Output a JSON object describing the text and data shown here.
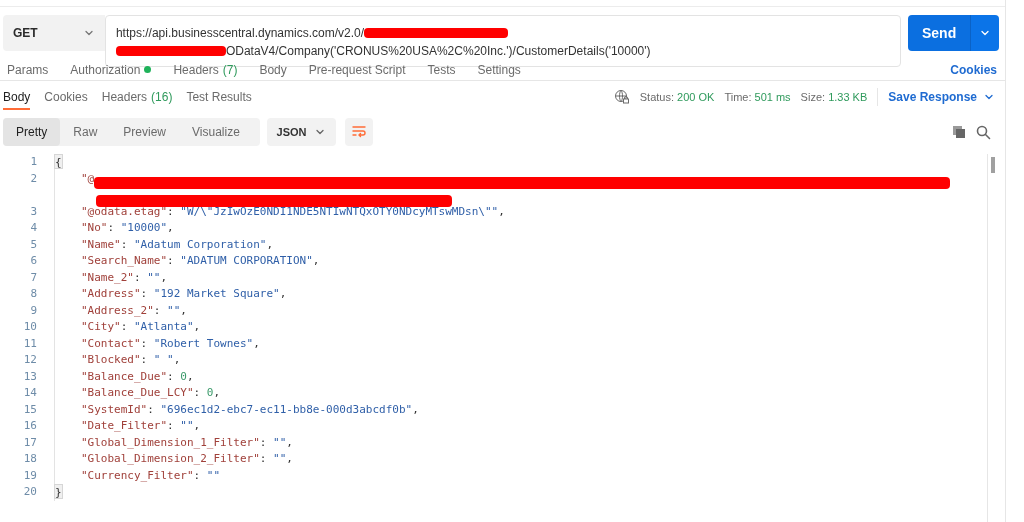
{
  "request": {
    "method": "GET",
    "url_line_1": "https://api.businesscentral.dynamics.com/v2.0/",
    "url_line_2": "ODataV4/Company('CRONUS%20USA%2C%20Inc.')/CustomerDetails('10000')",
    "send_label": "Send"
  },
  "request_tabs": [
    {
      "label": "Params",
      "selected": false
    },
    {
      "label": "Authorization",
      "dot": true,
      "selected": false
    },
    {
      "label": "Headers",
      "count": "(7)",
      "selected": false
    },
    {
      "label": "Body",
      "selected": false
    },
    {
      "label": "Pre-request Script",
      "selected": false
    },
    {
      "label": "Tests",
      "selected": false
    },
    {
      "label": "Settings",
      "selected": false
    }
  ],
  "cookies_link": "Cookies",
  "response_tabs": [
    {
      "label": "Body",
      "selected": true
    },
    {
      "label": "Cookies",
      "selected": false
    },
    {
      "label": "Headers",
      "count": "(16)",
      "selected": false
    },
    {
      "label": "Test Results",
      "selected": false
    }
  ],
  "status": [
    {
      "label": "Status:",
      "value": "200 OK"
    },
    {
      "label": "Time:",
      "value": "501 ms"
    },
    {
      "label": "Size:",
      "value": "1.33 KB"
    }
  ],
  "save_response": "Save Response",
  "view_modes": [
    {
      "label": "Pretty",
      "selected": true
    },
    {
      "label": "Raw",
      "selected": false
    },
    {
      "label": "Preview",
      "selected": false
    },
    {
      "label": "Visualize",
      "selected": false
    }
  ],
  "format": "JSON",
  "code_lines": [
    {
      "number": "1",
      "parts": [
        {
          "kind": "brace",
          "text": "{"
        }
      ]
    },
    {
      "number": "2",
      "parts": [
        {
          "kind": "key",
          "text": "\"@"
        },
        {
          "kind": "redaction"
        }
      ]
    },
    {
      "number": "3",
      "parts": [
        {
          "kind": "key",
          "text": "\"@odata.etag\""
        },
        {
          "kind": "punct",
          "text": ": "
        },
        {
          "kind": "string",
          "text": "\"W/\\\"JzIwOzE0NDI1NDE5NTIwNTQxOTY0NDcyMTswMDsn\\\"\""
        },
        {
          "kind": "punct",
          "text": ","
        }
      ]
    },
    {
      "number": "4",
      "parts": [
        {
          "kind": "key",
          "text": "\"No\""
        },
        {
          "kind": "punct",
          "text": ": "
        },
        {
          "kind": "string",
          "text": "\"10000\""
        },
        {
          "kind": "punct",
          "text": ","
        }
      ]
    },
    {
      "number": "5",
      "parts": [
        {
          "kind": "key",
          "text": "\"Name\""
        },
        {
          "kind": "punct",
          "text": ": "
        },
        {
          "kind": "string",
          "text": "\"Adatum Corporation\""
        },
        {
          "kind": "punct",
          "text": ","
        }
      ]
    },
    {
      "number": "6",
      "parts": [
        {
          "kind": "key",
          "text": "\"Search_Name\""
        },
        {
          "kind": "punct",
          "text": ": "
        },
        {
          "kind": "string",
          "text": "\"ADATUM CORPORATION\""
        },
        {
          "kind": "punct",
          "text": ","
        }
      ]
    },
    {
      "number": "7",
      "parts": [
        {
          "kind": "key",
          "text": "\"Name_2\""
        },
        {
          "kind": "punct",
          "text": ": "
        },
        {
          "kind": "string",
          "text": "\"\""
        },
        {
          "kind": "punct",
          "text": ","
        }
      ]
    },
    {
      "number": "8",
      "parts": [
        {
          "kind": "key",
          "text": "\"Address\""
        },
        {
          "kind": "punct",
          "text": ": "
        },
        {
          "kind": "string",
          "text": "\"192 Market Square\""
        },
        {
          "kind": "punct",
          "text": ","
        }
      ]
    },
    {
      "number": "9",
      "parts": [
        {
          "kind": "key",
          "text": "\"Address_2\""
        },
        {
          "kind": "punct",
          "text": ": "
        },
        {
          "kind": "string",
          "text": "\"\""
        },
        {
          "kind": "punct",
          "text": ","
        }
      ]
    },
    {
      "number": "10",
      "parts": [
        {
          "kind": "key",
          "text": "\"City\""
        },
        {
          "kind": "punct",
          "text": ": "
        },
        {
          "kind": "string",
          "text": "\"Atlanta\""
        },
        {
          "kind": "punct",
          "text": ","
        }
      ]
    },
    {
      "number": "11",
      "parts": [
        {
          "kind": "key",
          "text": "\"Contact\""
        },
        {
          "kind": "punct",
          "text": ": "
        },
        {
          "kind": "string",
          "text": "\"Robert Townes\""
        },
        {
          "kind": "punct",
          "text": ","
        }
      ]
    },
    {
      "number": "12",
      "parts": [
        {
          "kind": "key",
          "text": "\"Blocked\""
        },
        {
          "kind": "punct",
          "text": ": "
        },
        {
          "kind": "string",
          "text": "\" \""
        },
        {
          "kind": "punct",
          "text": ","
        }
      ]
    },
    {
      "number": "13",
      "parts": [
        {
          "kind": "key",
          "text": "\"Balance_Due\""
        },
        {
          "kind": "punct",
          "text": ": "
        },
        {
          "kind": "number",
          "text": "0"
        },
        {
          "kind": "punct",
          "text": ","
        }
      ]
    },
    {
      "number": "14",
      "parts": [
        {
          "kind": "key",
          "text": "\"Balance_Due_LCY\""
        },
        {
          "kind": "punct",
          "text": ": "
        },
        {
          "kind": "number",
          "text": "0"
        },
        {
          "kind": "punct",
          "text": ","
        }
      ]
    },
    {
      "number": "15",
      "parts": [
        {
          "kind": "key",
          "text": "\"SystemId\""
        },
        {
          "kind": "punct",
          "text": ": "
        },
        {
          "kind": "string",
          "text": "\"696ec1d2-ebc7-ec11-bb8e-000d3abcdf0b\""
        },
        {
          "kind": "punct",
          "text": ","
        }
      ]
    },
    {
      "number": "16",
      "parts": [
        {
          "kind": "key",
          "text": "\"Date_Filter\""
        },
        {
          "kind": "punct",
          "text": ": "
        },
        {
          "kind": "string",
          "text": "\"\""
        },
        {
          "kind": "punct",
          "text": ","
        }
      ]
    },
    {
      "number": "17",
      "parts": [
        {
          "kind": "key",
          "text": "\"Global_Dimension_1_Filter\""
        },
        {
          "kind": "punct",
          "text": ": "
        },
        {
          "kind": "string",
          "text": "\"\""
        },
        {
          "kind": "punct",
          "text": ","
        }
      ]
    },
    {
      "number": "18",
      "parts": [
        {
          "kind": "key",
          "text": "\"Global_Dimension_2_Filter\""
        },
        {
          "kind": "punct",
          "text": ": "
        },
        {
          "kind": "string",
          "text": "\"\""
        },
        {
          "kind": "punct",
          "text": ","
        }
      ]
    },
    {
      "number": "19",
      "parts": [
        {
          "kind": "key",
          "text": "\"Currency_Filter\""
        },
        {
          "kind": "punct",
          "text": ": "
        },
        {
          "kind": "string",
          "text": "\"\""
        }
      ]
    },
    {
      "number": "20",
      "parts": [
        {
          "kind": "brace",
          "text": "}"
        }
      ]
    }
  ]
}
